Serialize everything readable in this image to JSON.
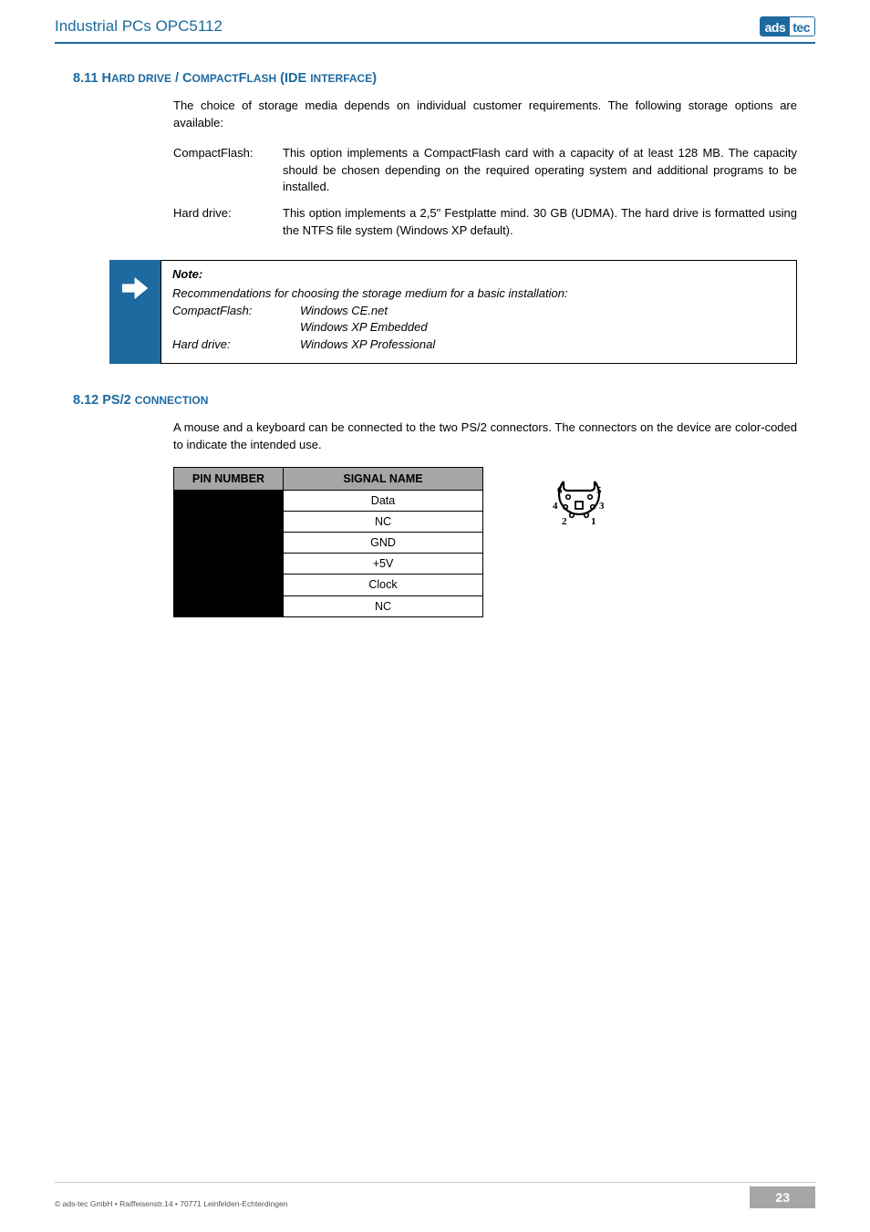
{
  "header": {
    "title": "Industrial PCs OPC5112",
    "logo_left": "ads",
    "logo_right": "tec"
  },
  "sec811": {
    "heading_num": "8.11 ",
    "heading_a": "H",
    "heading_b": "ARD DRIVE",
    "heading_c": " / C",
    "heading_d": "OMPACT",
    "heading_e": "F",
    "heading_f": "LASH",
    "heading_g": " (IDE ",
    "heading_h": "INTERFACE",
    "heading_i": ")",
    "intro": "The choice of storage media depends on individual customer requirements. The following storage options are available:",
    "row1_term": "CompactFlash:",
    "row1_desc": "This option implements a CompactFlash card with a capacity of at least 128 MB. The capacity should be chosen depending on the required operating system and additional programs to be installed.",
    "row2_term": "Hard drive:",
    "row2_desc": "This option implements a 2,5\" Festplatte mind. 30 GB (UDMA). The hard drive is formatted using the NTFS file system (Windows XP default)."
  },
  "note": {
    "title": "Note:",
    "line1": "Recommendations for choosing the storage medium for a basic installation:",
    "cf_label": "CompactFlash:",
    "cf_v1": "Windows CE.net",
    "cf_v2": "Windows XP Embedded",
    "hd_label": "Hard drive:",
    "hd_v1": "Windows XP Professional"
  },
  "sec812": {
    "heading_num": "8.12 ",
    "heading_a": "PS/2 ",
    "heading_b": "CONNECTION",
    "intro": "A mouse and a keyboard can be connected to the two PS/2 connectors. The connectors on the device are color-coded to indicate the intended use.",
    "th1": "PIN NUMBER",
    "th2": "SIGNAL NAME",
    "rows": [
      "Data",
      "NC",
      "GND",
      "+5V",
      "Clock",
      "NC"
    ],
    "conn_labels": {
      "p1": "1",
      "p2": "2",
      "p3": "3",
      "p4": "4",
      "p5": "5",
      "p6": "6"
    }
  },
  "footer": {
    "copyright": "© ads-tec GmbH • Raiffeisenstr.14 • 70771 Leinfelden-Echterdingen",
    "page": "23"
  }
}
